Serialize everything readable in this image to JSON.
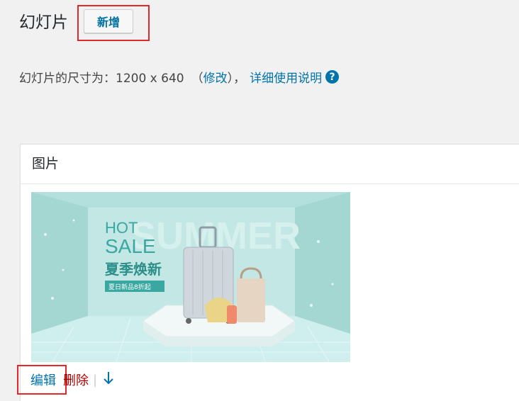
{
  "header": {
    "title": "幻灯片",
    "add_new_label": "新增"
  },
  "description": {
    "size_text": "幻灯片的尺寸为：1200 x 640",
    "open_paren": "（",
    "modify_label": "修改",
    "close_paren": "），",
    "help_label": "详细使用说明",
    "help_icon": "question-circle-icon"
  },
  "panel": {
    "header": "图片",
    "banner": {
      "bg_word": "SUMMER",
      "hot": "HOT",
      "sale": "SALE",
      "headline": "夏季焕新",
      "tag": "夏日新品8折起"
    },
    "actions": {
      "edit": "编辑",
      "delete": "删除",
      "separator": "|",
      "move_down_icon": "arrow-down-icon"
    }
  },
  "colors": {
    "background": "#f1f1f1",
    "link": "#0073aa",
    "delete": "#aa0000",
    "highlight": "#e02a2a",
    "banner": "#aedcd9"
  }
}
